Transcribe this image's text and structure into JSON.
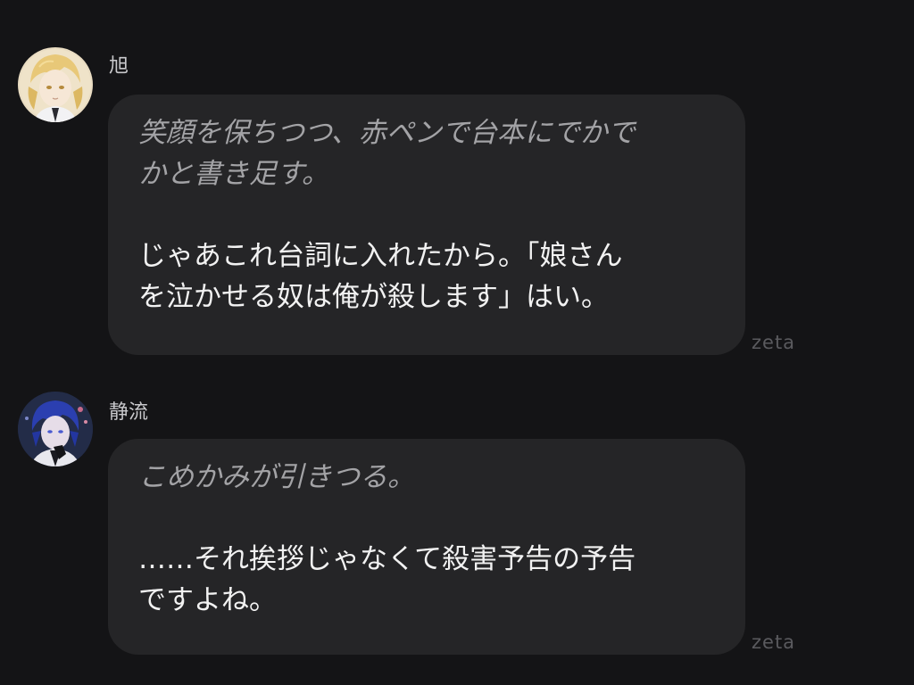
{
  "messages": [
    {
      "sender": "旭",
      "avatar_icon": "blonde-character-avatar",
      "narration_lines": [
        "笑顔を保ちつつ、赤ペンで台本にでかで",
        "かと書き足す。"
      ],
      "dialogue_lines": [
        "じゃあこれ台詞に入れたから。「娘さん",
        "を泣かせる奴は俺が殺します」はい。"
      ],
      "watermark": "zeta"
    },
    {
      "sender": "静流",
      "avatar_icon": "blue-haired-character-avatar",
      "narration_lines": [
        "こめかみが引きつる。"
      ],
      "dialogue_lines": [
        "……それ挨拶じゃなくて殺害予告の予告",
        "ですよね。"
      ],
      "watermark": "zeta"
    }
  ],
  "colors": {
    "background": "#141416",
    "bubble": "#252527",
    "narration_text": "#a3a3a6",
    "dialogue_text": "#f2f2f2",
    "watermark": "#5a5a5e"
  }
}
